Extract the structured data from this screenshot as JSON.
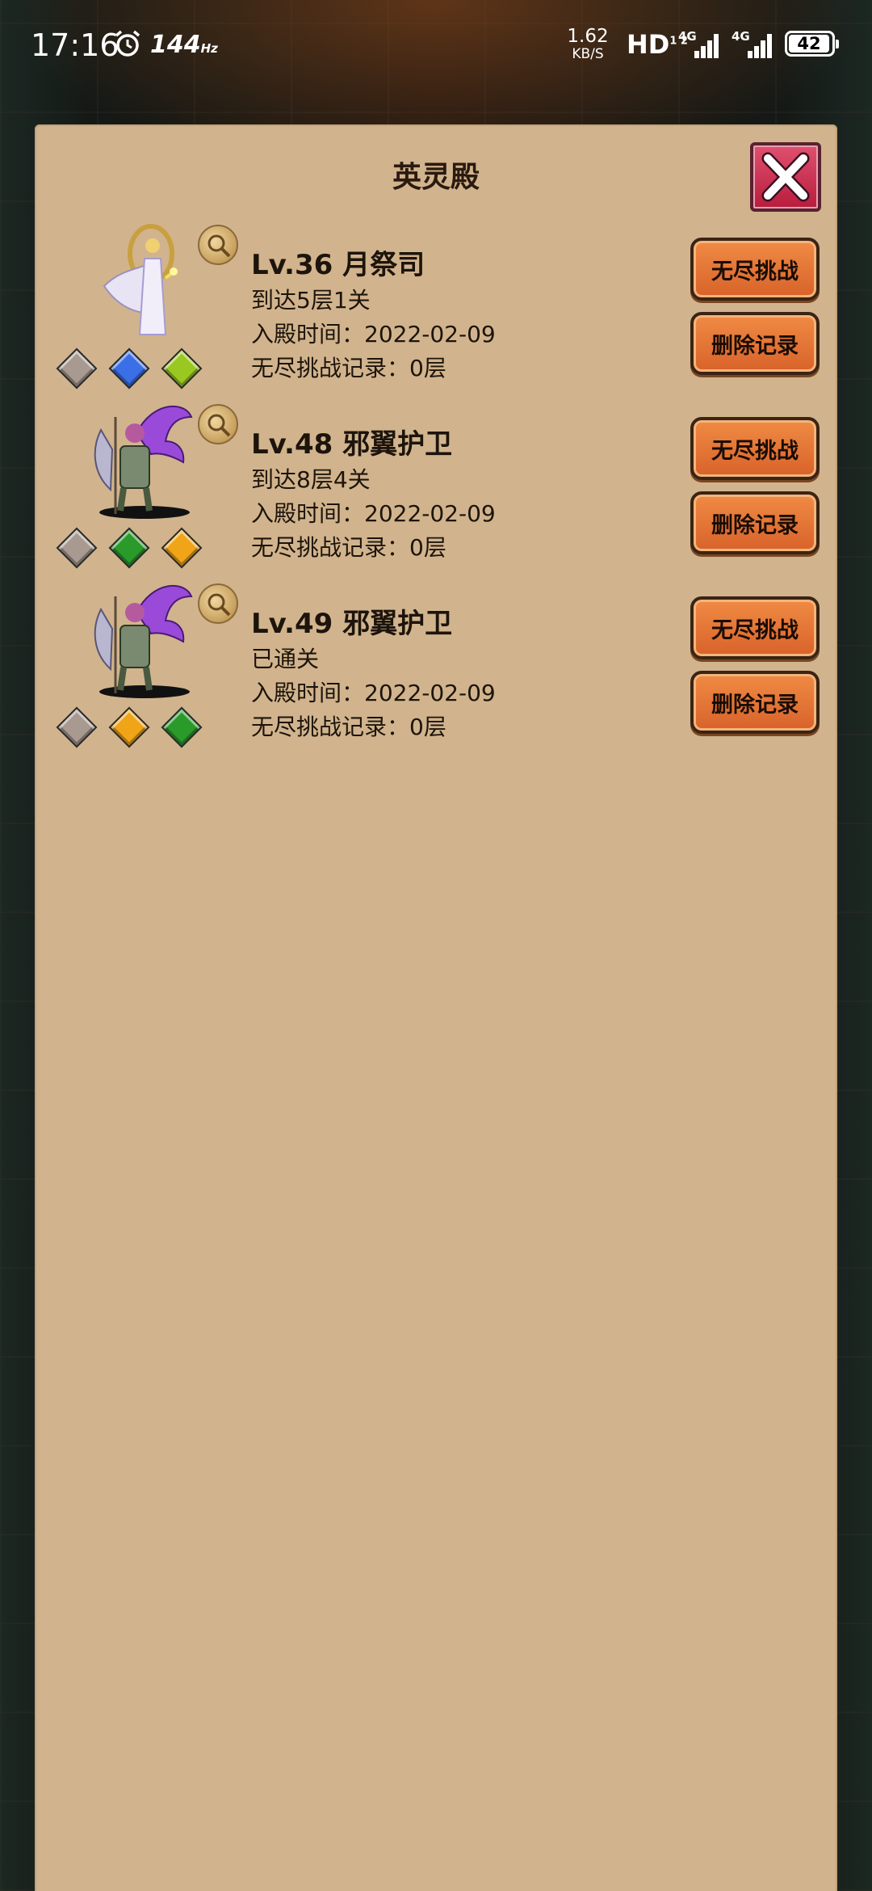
{
  "status_bar": {
    "time": "17:16",
    "refresh_rate": "144",
    "refresh_unit": "Hz",
    "net_speed_value": "1.62",
    "net_speed_unit": "KB/S",
    "hd_label": "HD",
    "hd_sup": "1 2",
    "sim1_label": "4G",
    "sim2_label": "4G",
    "battery": "42"
  },
  "panel": {
    "title": "英灵殿"
  },
  "heroes": [
    {
      "name": "Lv.36 月祭司",
      "progress": "到达5层1关",
      "enter_time": "入殿时间：2022-02-09",
      "endless_record": "无尽挑战记录：0层",
      "gems": [
        "#a89a90",
        "#3a6fe8",
        "#9ac820"
      ],
      "endless_button": "无尽挑战",
      "delete_button": "删除记录"
    },
    {
      "name": "Lv.48 邪翼护卫",
      "progress": "到达8层4关",
      "enter_time": "入殿时间：2022-02-09",
      "endless_record": "无尽挑战记录：0层",
      "gems": [
        "#a89a90",
        "#2a9a2a",
        "#f0a418"
      ],
      "endless_button": "无尽挑战",
      "delete_button": "删除记录"
    },
    {
      "name": "Lv.49 邪翼护卫",
      "progress": "已通关",
      "enter_time": "入殿时间：2022-02-09",
      "endless_record": "无尽挑战记录：0层",
      "gems": [
        "#a89a90",
        "#f0a418",
        "#2a9a2a"
      ],
      "endless_button": "无尽挑战",
      "delete_button": "删除记录"
    }
  ]
}
